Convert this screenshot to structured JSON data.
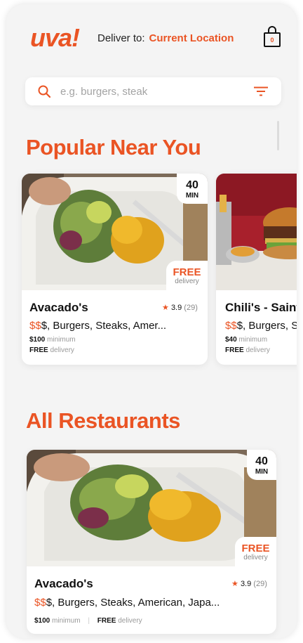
{
  "header": {
    "logo": "uva!",
    "deliver_label": "Deliver to:",
    "location": "Current Location",
    "cart_count": "0"
  },
  "search": {
    "placeholder": "e.g. burgers, steak"
  },
  "sections": {
    "popular_title": "Popular Near You",
    "all_title": "All Restaurants"
  },
  "popular": [
    {
      "name": "Avacado's",
      "rating": "3.9",
      "reviews": "(29)",
      "price_active": "$$",
      "price_rest": "$, Burgers, Steaks, Amer...",
      "minimum_value": "$100",
      "minimum_label": "minimum",
      "delivery_value": "FREE",
      "delivery_label": "delivery",
      "time_value": "40",
      "time_unit": "MIN",
      "free_badge": "FREE",
      "free_badge_sub": "delivery"
    },
    {
      "name": "Chili's - Saint",
      "price_active": "$$",
      "price_rest": "$, Burgers, St",
      "minimum_value": "$40",
      "minimum_label": "minimum",
      "delivery_value": "FREE",
      "delivery_label": "delivery"
    }
  ],
  "all_restaurants": [
    {
      "name": "Avacado's",
      "rating": "3.9",
      "reviews": "(29)",
      "price_active": "$$",
      "price_rest": "$, Burgers, Steaks, American, Japa...",
      "minimum_value": "$100",
      "minimum_label": "minimum",
      "delivery_value": "FREE",
      "delivery_label": "delivery",
      "time_value": "40",
      "time_unit": "MIN",
      "free_badge": "FREE",
      "free_badge_sub": "delivery"
    }
  ],
  "colors": {
    "accent": "#ea5424",
    "background": "#f4f4f4"
  },
  "icons": {
    "search": "search-icon",
    "filter": "filter-icon",
    "cart": "shopping-bag-icon",
    "star": "star-icon"
  }
}
